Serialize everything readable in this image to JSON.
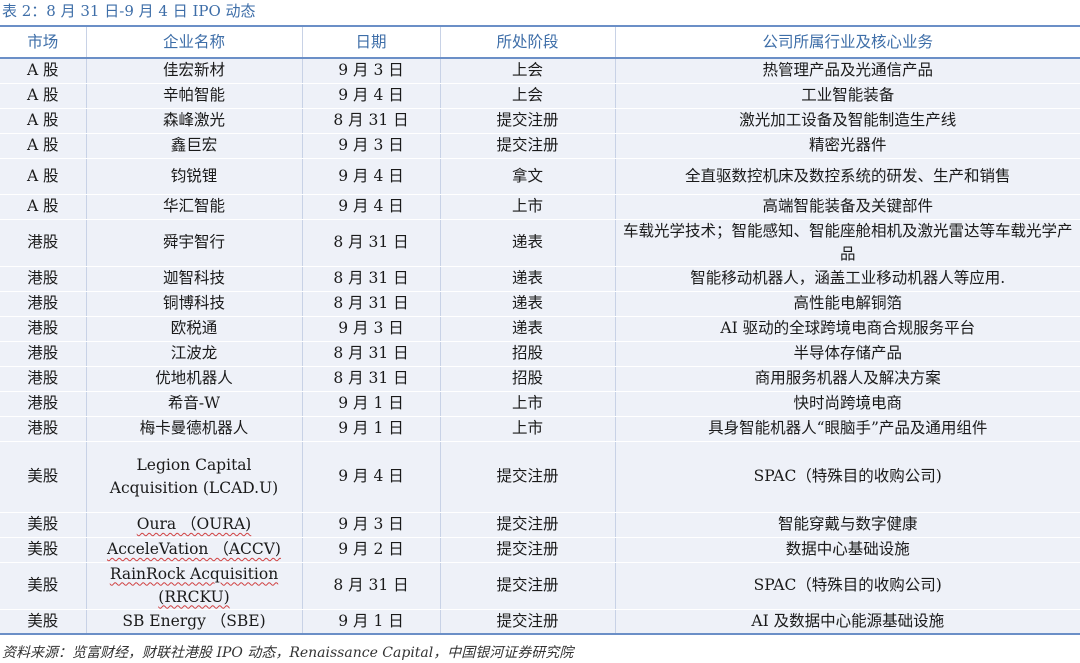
{
  "caption": "表 2：8 月 31 日-9 月 4 日 IPO 动态",
  "headers": [
    "市场",
    "企业名称",
    "日期",
    "所处阶段",
    "公司所属行业及核心业务"
  ],
  "rows": [
    {
      "market": "A 股",
      "name": "佳宏新材",
      "date": "9 月 3 日",
      "stage": "上会",
      "business": "热管理产品及光通信产品"
    },
    {
      "market": "A 股",
      "name": "辛帕智能",
      "date": "9 月 4 日",
      "stage": "上会",
      "business": "工业智能装备"
    },
    {
      "market": "A 股",
      "name": "森峰激光",
      "date": "8 月 31 日",
      "stage": "提交注册",
      "business": "激光加工设备及智能制造生产线"
    },
    {
      "market": "A 股",
      "name": "鑫巨宏",
      "date": "9 月 3 日",
      "stage": "提交注册",
      "business": "精密光器件"
    },
    {
      "market": "A 股",
      "name": "钧锐锂",
      "date": "9 月 4 日",
      "stage": "拿文",
      "business": "全直驱数控机床及数控系统的研发、生产和销售"
    },
    {
      "market": "A 股",
      "name": "华汇智能",
      "date": "9 月 4 日",
      "stage": "上市",
      "business": "高端智能装备及关键部件"
    },
    {
      "market": "港股",
      "name": "舜宇智行",
      "date": "8 月 31 日",
      "stage": "递表",
      "business": "车载光学技术；智能感知、智能座舱相机及激光雷达等车载光学产品"
    },
    {
      "market": "港股",
      "name": "迦智科技",
      "date": "8 月 31 日",
      "stage": "递表",
      "business": "智能移动机器人，涵盖工业移动机器人等应用."
    },
    {
      "market": "港股",
      "name": "铜博科技",
      "date": "8 月 31 日",
      "stage": "递表",
      "business": "高性能电解铜箔"
    },
    {
      "market": "港股",
      "name": "欧税通",
      "date": "9 月 3 日",
      "stage": "递表",
      "business": "AI 驱动的全球跨境电商合规服务平台"
    },
    {
      "market": "港股",
      "name": "江波龙",
      "date": "8 月 31 日",
      "stage": "招股",
      "business": "半导体存储产品"
    },
    {
      "market": "港股",
      "name": "优地机器人",
      "date": "8 月 31 日",
      "stage": "招股",
      "business": "商用服务机器人及解决方案"
    },
    {
      "market": "港股",
      "name": "希音-W",
      "date": "9 月 1 日",
      "stage": "上市",
      "business": "快时尚跨境电商"
    },
    {
      "market": "港股",
      "name": "梅卡曼德机器人",
      "date": "9 月 1 日",
      "stage": "上市",
      "business": "具身智能机器人“眼脑手”产品及通用组件"
    },
    {
      "market": "美股",
      "name": "Legion Capital Acquisition (LCAD.U)",
      "date": "9 月 4 日",
      "stage": "提交注册",
      "business": "SPAC（特殊目的收购公司)"
    },
    {
      "market": "美股",
      "name": "Oura （OURA)",
      "date": "9 月 3 日",
      "stage": "提交注册",
      "business": "智能穿戴与数字健康"
    },
    {
      "market": "美股",
      "name": "AcceleVation （ACCV)",
      "date": "9 月 2 日",
      "stage": "提交注册",
      "business": "数据中心基础设施"
    },
    {
      "market": "美股",
      "name": "RainRock Acquisition (RRCKU)",
      "date": "8 月 31 日",
      "stage": "提交注册",
      "business": "SPAC（特殊目的收购公司)"
    },
    {
      "market": "美股",
      "name": "SB Energy （SBE)",
      "date": "9 月 1 日",
      "stage": "提交注册",
      "business": "AI 及数据中心能源基础设施"
    }
  ],
  "source": "资料来源：览富财经，财联社港股 IPO 动态，Renaissance Capital，中国银河证券研究院"
}
